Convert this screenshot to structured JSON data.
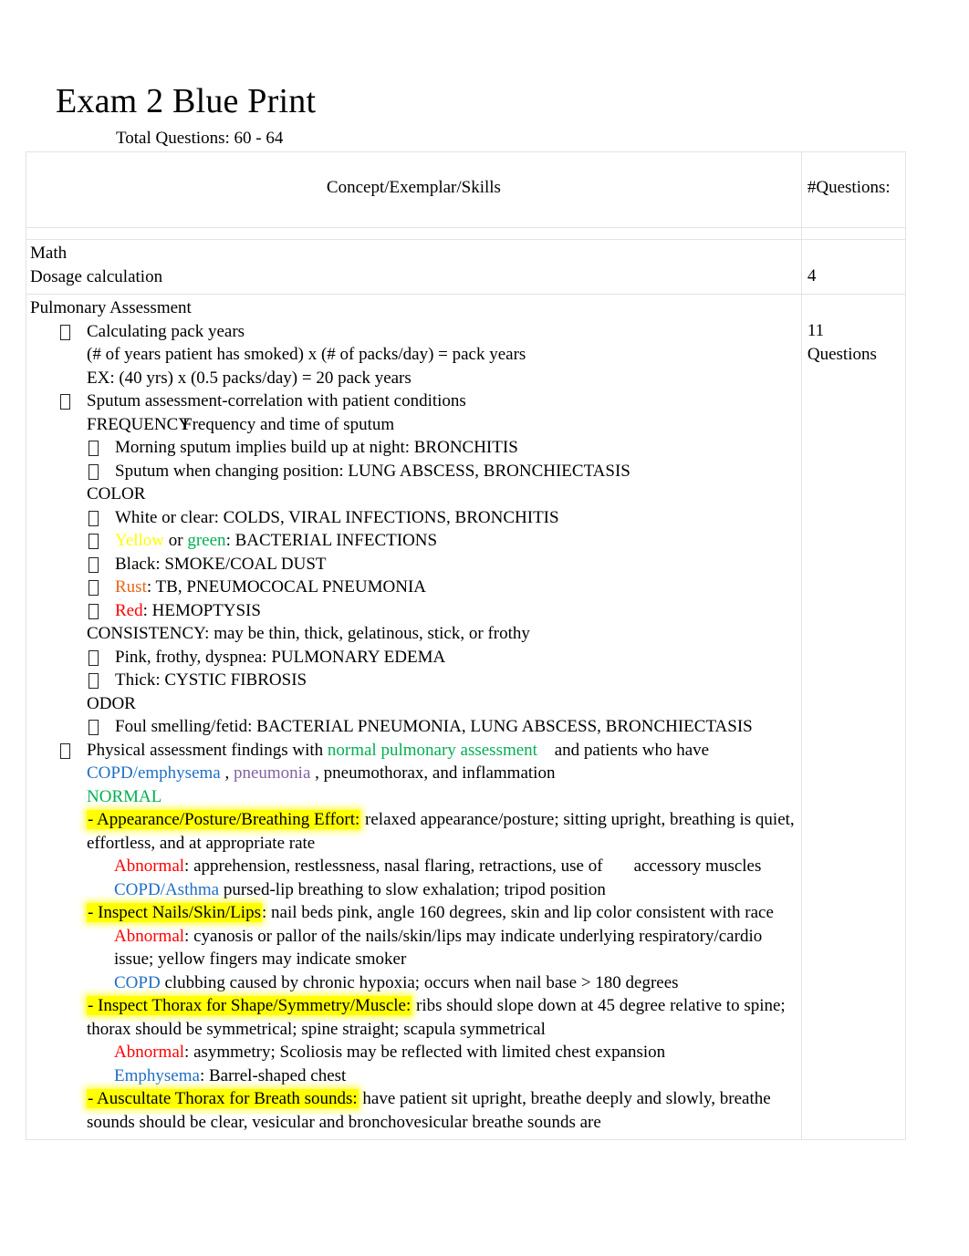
{
  "document": {
    "title": "Exam 2 Blue Print",
    "subtitle": "Total Questions:   60 - 64"
  },
  "table": {
    "headers": {
      "concept": "Concept/Exemplar/Skills",
      "questions": "#Questions:"
    },
    "rows": [
      {
        "section": "Math",
        "item": " Dosage calculation",
        "questions": "4"
      },
      {
        "section": "Pulmonary Assessment",
        "questions_line1": "11",
        "questions_line2": "Questions"
      }
    ]
  },
  "pulmonary": {
    "bullet_pack_years": "Calculating pack years",
    "pack_years_formula": "(# of years patient has smoked) x (# of packs/day) = pack years",
    "pack_years_example": "EX: (40 yrs) x (0.5 packs/day) = 20 pack years",
    "bullet_sputum": "Sputum assessment-correlation with patient conditions",
    "frequency_label": "FREQUENCY",
    "frequency_text": "Frequency and time of sputum",
    "frequency_items": [
      "Morning sputum implies build up at night: BRONCHITIS",
      "Sputum when changing position: LUNG ABSCESS, BRONCHIECTASIS"
    ],
    "color_label": "COLOR",
    "color_items": {
      "white": "White or clear: COLDS, VIRAL INFECTIONS, BRONCHITIS",
      "yellow_word": "Yellow",
      "or_word": " or ",
      "green_word": "green",
      "bacterial_rest": ": BACTERIAL INFECTIONS",
      "black": "Black: SMOKE/COAL DUST",
      "rust_word": "Rust",
      "rust_rest": ": TB, PNEUMOCOCAL PNEUMONIA",
      "red_word": "Red",
      "red_rest": ": HEMOPTYSIS"
    },
    "consistency_line": "CONSISTENCY: may be thin, thick, gelatinous, stick, or frothy",
    "consistency_items": [
      "Pink, frothy, dyspnea: PULMONARY EDEMA",
      "Thick: CYSTIC FIBROSIS"
    ],
    "odor_label": "ODOR",
    "odor_item": "Foul smelling/fetid: BACTERIAL PNEUMONIA, LUNG ABSCESS, BRONCHIECTASIS",
    "physical": {
      "lead": "Physical assessment findings with ",
      "normal_assessment": "normal pulmonary assessment",
      "mid": " and patients who have ",
      "copd_emphysema": "COPD/emphysema",
      "comma1": " , ",
      "pneumonia": "pneumonia",
      "tail": " , pneumothorax, and inflammation"
    },
    "normal_label": "NORMAL",
    "appearance": {
      "highlight": "- Appearance/Posture/Breathing Effort:",
      "text": " relaxed appearance/posture; sitting upright, breathing is quiet, effortless, and at appropriate rate",
      "abnormal_word": "Abnormal",
      "abnormal_text": ": apprehension, restlessness, nasal flaring, retractions, use of",
      "abnormal_text2": "accessory muscles",
      "copd_asthma": "COPD/Asthma",
      "copd_asthma_text": " pursed-lip breathing to slow exhalation; tripod position"
    },
    "nails": {
      "highlight": "- Inspect Nails/Skin/Lips",
      "text": ": nail beds pink, angle 160 degrees, skin and lip color consistent with race",
      "abnormal_word": "Abnormal",
      "abnormal_text": ": cyanosis or pallor of the nails/skin/lips may indicate underlying respiratory/cardio issue; yellow fingers may indicate smoker",
      "copd_word": "COPD",
      "copd_text": " clubbing caused by chronic hypoxia; occurs when nail base > 180 degrees"
    },
    "thorax": {
      "highlight": "- Inspect Thorax for Shape/Symmetry/Muscle:",
      "text": " ribs should slope down at 45 degree relative to spine; thorax should be symmetrical; spine straight; scapula symmetrical",
      "abnormal_word": "Abnormal",
      "abnormal_text": ": asymmetry; Scoliosis may be reflected with limited chest expansion",
      "emphysema_word": "Emphysema",
      "emphysema_text": ": Barrel-shaped chest"
    },
    "auscultate": {
      "highlight": "- Auscultate Thorax for Breath sounds:",
      "text": " have patient sit upright, breathe deeply and slowly, breathe sounds should be clear, vesicular and bronchovesicular breathe sounds are"
    }
  }
}
